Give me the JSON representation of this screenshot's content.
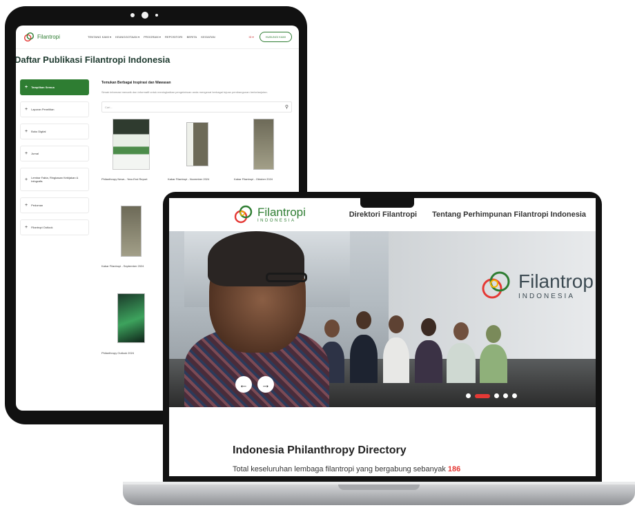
{
  "tablet": {
    "nav": {
      "logo_text": "Filantropi",
      "menu": [
        "TENTANG KAMI ▾",
        "KEANGGOTAAN ▾",
        "PROGRAM ▾",
        "REPOSITORI",
        "BERITA",
        "KEGIATAN"
      ],
      "lang": "ID ▾",
      "cta": "HUBUNGI KAMI"
    },
    "page_title": "Daftar Publikasi Filantropi Indonesia",
    "sidebar": [
      {
        "label": "Tampilkan Semua",
        "active": true
      },
      {
        "label": "Laporan Penelitian"
      },
      {
        "label": "Buku Digital"
      },
      {
        "label": "Jurnal"
      },
      {
        "label": "Lembar Fakta, Ringkasan Kebijakan & Infografis"
      },
      {
        "label": "Pedoman"
      },
      {
        "label": "Filantropi Outlook"
      }
    ],
    "main": {
      "heading": "Temukan Berbagai Inspirasi dan Wawasan",
      "subheading": "Simak informasi menarik dan informatif untuk meningkatkan pengetahuan anda mengenai berbagai tujuan pembangunan berkelanjutan.",
      "search_placeholder": "Cari..."
    },
    "publications": [
      {
        "label": "Philanthropy News - Year-End Report"
      },
      {
        "label": "Kabar Filantropi - November 2024"
      },
      {
        "label": "Kabar Filantropi - Oktober 2024"
      },
      {
        "label": "Kabar Filantropi - September 2024"
      },
      {
        "label": "Philanthropy Outlook 2024"
      }
    ]
  },
  "laptop": {
    "nav": {
      "logo_main": "Filantropi",
      "logo_sub": "INDONESIA",
      "menu": [
        "Direktori Filantropi",
        "Tentang Perhimpunan Filantropi Indonesia"
      ]
    },
    "hero": {
      "sign_main": "Filantrop",
      "sign_sub": "INDONESIA",
      "prev_icon": "←",
      "next_icon": "→",
      "slides": 5,
      "active_slide": 2
    },
    "directory": {
      "title": "Indonesia Philanthropy Directory",
      "subtitle": "Total keseluruhan lembaga filantropi yang bergabung sebanyak",
      "count": "186"
    }
  },
  "colors": {
    "brand_green": "#2e7d32",
    "accent_red": "#e53935"
  }
}
